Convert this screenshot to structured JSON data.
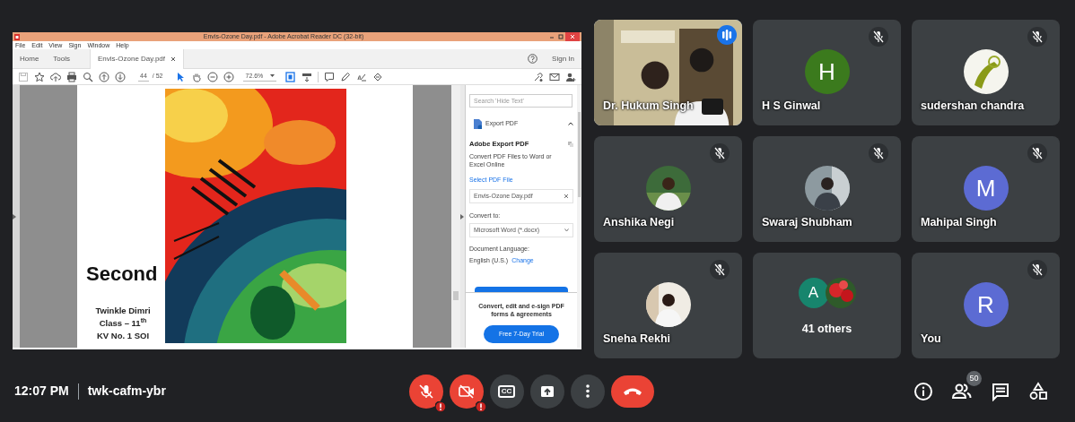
{
  "shared_screen": {
    "title": "Envis-Ozone Day.pdf - Adobe Acrobat Reader DC (32-bit)",
    "menu": [
      "File",
      "Edit",
      "View",
      "Sign",
      "Window",
      "Help"
    ],
    "tabs": [
      {
        "label": "Home",
        "selected": false
      },
      {
        "label": "Tools",
        "selected": false
      },
      {
        "label": "Envis-Ozone Day.pdf",
        "selected": true
      }
    ],
    "sign_in": "Sign In",
    "page_number": "44",
    "page_count": "/ 52",
    "zoom": "72.6%",
    "page": {
      "heading": "Second",
      "lines": [
        "Twinkle Dimri",
        "Class – 11$^{th}$",
        "KV No. 1 SOI"
      ]
    },
    "panel": {
      "search_placeholder": "Search 'Hide Text'",
      "section": "Export PDF",
      "title": "Adobe Export PDF",
      "description": "Convert PDF Files to Word or Excel Online",
      "select_link": "Select PDF File",
      "file": "Envis-Ozone Day.pdf",
      "convert_label": "Convert to:",
      "convert_value": "Microsoft Word (*.docx)",
      "language_label": "Document Language:",
      "language_value": "English (U.S.)",
      "change_link": "Change",
      "promo": "Convert, edit and e-sign PDF forms & agreements",
      "trial_button": "Free 7-Day Trial"
    }
  },
  "participants": [
    {
      "kind": "video",
      "name": "Dr. Hukum Singh",
      "muted": false,
      "speaking": true
    },
    {
      "kind": "initial",
      "name": "H S Ginwal",
      "initial": "H",
      "color": "#3b7a1d",
      "muted": true,
      "speaking": false
    },
    {
      "kind": "picture",
      "name": "sudershan chandra",
      "muted": true,
      "speaking": false
    },
    {
      "kind": "picture",
      "name": "Anshika Negi",
      "muted": true,
      "speaking": false
    },
    {
      "kind": "picture",
      "name": "Swaraj Shubham",
      "muted": true,
      "speaking": false
    },
    {
      "kind": "initial",
      "name": "Mahipal Singh",
      "initial": "M",
      "color": "#5c6bd3",
      "muted": true,
      "speaking": false
    },
    {
      "kind": "picture",
      "name": "Sneha Rekhi",
      "muted": true,
      "speaking": false
    },
    {
      "kind": "group",
      "name": "41 others",
      "initial": "A",
      "color": "#17856d",
      "muted": false,
      "speaking": false
    },
    {
      "kind": "initial",
      "name": "You",
      "initial": "R",
      "color": "#5c6bd3",
      "muted": true,
      "speaking": false
    }
  ],
  "meeting": {
    "time": "12:07 PM",
    "code": "twk-cafm-ybr",
    "participant_count": "50",
    "mic_on": false,
    "camera_on": false,
    "captions": "CC"
  }
}
